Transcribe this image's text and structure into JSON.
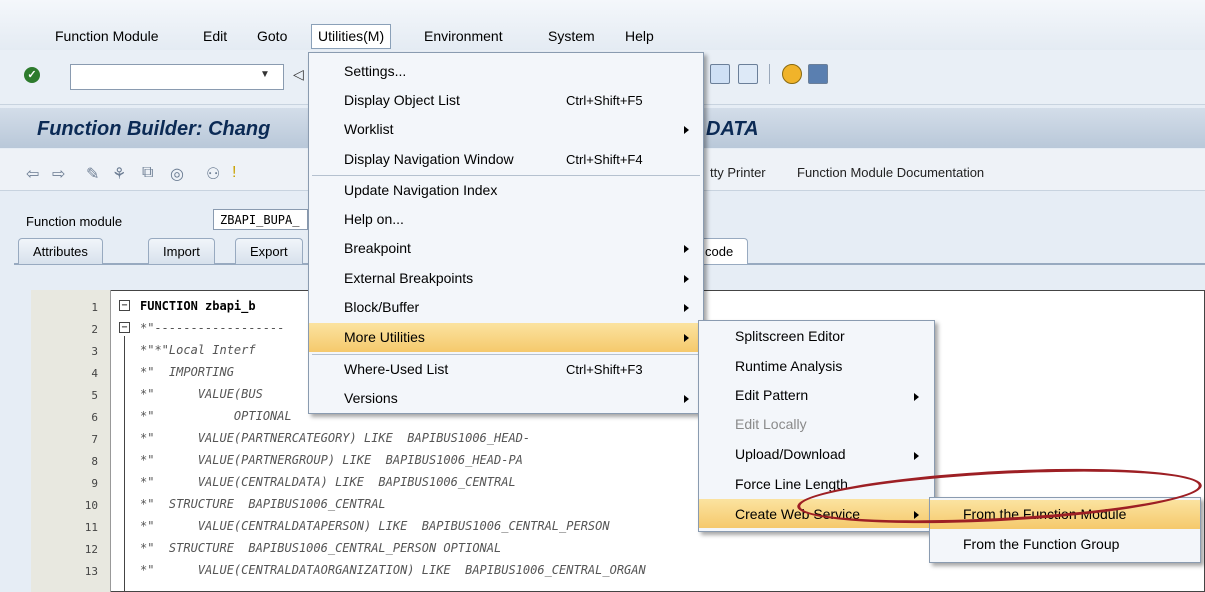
{
  "menubar": {
    "items": [
      {
        "label": "Function Module"
      },
      {
        "label": "Edit"
      },
      {
        "label": "Goto"
      },
      {
        "label": "Utilities(M)"
      },
      {
        "label": "Environment"
      },
      {
        "label": "System"
      },
      {
        "label": "Help"
      }
    ]
  },
  "header": {
    "title_left": "Function Builder: Chang",
    "title_right": "DATA"
  },
  "app_toolbar": {
    "pretty_printer": "tty Printer",
    "documentation": "Function Module Documentation"
  },
  "function_module": {
    "label": "Function module",
    "value": "ZBAPI_BUPA_"
  },
  "tabs": [
    {
      "label": "Attributes"
    },
    {
      "label": "Import"
    },
    {
      "label": "Export"
    },
    {
      "label": "code"
    }
  ],
  "editor": {
    "lines": [
      {
        "n": "1",
        "text": "FUNCTION zbapi_b"
      },
      {
        "n": "2",
        "text": "*\"------------------"
      },
      {
        "n": "3",
        "text": "*\"*\"Local Interf"
      },
      {
        "n": "4",
        "text": "*\"  IMPORTING"
      },
      {
        "n": "5",
        "text": "*\"      VALUE(BUS"
      },
      {
        "n": "6",
        "text": "*\"           OPTIONAL"
      },
      {
        "n": "7",
        "text": "*\"      VALUE(PARTNERCATEGORY) LIKE  BAPIBUS1006_HEAD-"
      },
      {
        "n": "8",
        "text": "*\"      VALUE(PARTNERGROUP) LIKE  BAPIBUS1006_HEAD-PA"
      },
      {
        "n": "9",
        "text": "*\"      VALUE(CENTRALDATA) LIKE  BAPIBUS1006_CENTRAL"
      },
      {
        "n": "10",
        "text": "*\"  STRUCTURE  BAPIBUS1006_CENTRAL"
      },
      {
        "n": "11",
        "text": "*\"      VALUE(CENTRALDATAPERSON) LIKE  BAPIBUS1006_CENTRAL_PERSON"
      },
      {
        "n": "12",
        "text": "*\"  STRUCTURE  BAPIBUS1006_CENTRAL_PERSON OPTIONAL"
      },
      {
        "n": "13",
        "text": "*\"      VALUE(CENTRALDATAORGANIZATION) LIKE  BAPIBUS1006_CENTRAL_ORGAN"
      }
    ]
  },
  "utilities_menu": {
    "items": [
      {
        "label": "Settings...",
        "shortcut": ""
      },
      {
        "label": "Display Object List",
        "shortcut": "Ctrl+Shift+F5"
      },
      {
        "label": "Worklist",
        "shortcut": ""
      },
      {
        "label": "Display Navigation Window",
        "shortcut": "Ctrl+Shift+F4"
      },
      {
        "label": "Update Navigation Index",
        "shortcut": ""
      },
      {
        "label": "Help on...",
        "shortcut": ""
      },
      {
        "label": "Breakpoint",
        "shortcut": ""
      },
      {
        "label": "External Breakpoints",
        "shortcut": ""
      },
      {
        "label": "Block/Buffer",
        "shortcut": ""
      },
      {
        "label": "More Utilities",
        "shortcut": ""
      },
      {
        "label": "Where-Used List",
        "shortcut": "Ctrl+Shift+F3"
      },
      {
        "label": "Versions",
        "shortcut": ""
      }
    ]
  },
  "more_utilities_menu": {
    "items": [
      {
        "label": "Splitscreen Editor"
      },
      {
        "label": "Runtime Analysis"
      },
      {
        "label": "Edit Pattern"
      },
      {
        "label": "Edit Locally"
      },
      {
        "label": "Upload/Download"
      },
      {
        "label": "Force Line Length"
      },
      {
        "label": "Create Web Service"
      }
    ]
  },
  "web_service_menu": {
    "items": [
      {
        "label": "From the Function Module"
      },
      {
        "label": "From the Function Group"
      }
    ]
  },
  "colors": {
    "highlight": "#f5c96c",
    "annotation": "#9d1f24",
    "title": "#0b2a55"
  }
}
